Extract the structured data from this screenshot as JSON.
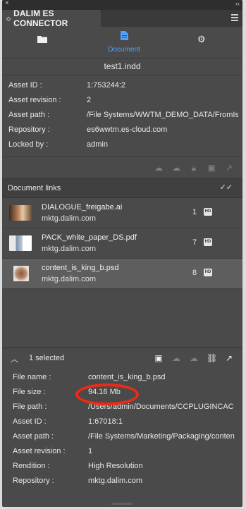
{
  "window": {
    "close": "×",
    "collapse": "‹‹"
  },
  "panel": {
    "title": "DALIM ES CONNECTOR"
  },
  "nav": {
    "document_label": "Document"
  },
  "file": {
    "name": "test1.indd"
  },
  "asset_info": [
    {
      "label": "Asset ID :",
      "value": "1:753244:2"
    },
    {
      "label": "Asset revision :",
      "value": "2"
    },
    {
      "label": "Asset path :",
      "value": "/File Systems/WWTM_DEMO_DATA/FromIsa"
    },
    {
      "label": "Repository :",
      "value": "es6wwtm.es-cloud.com"
    },
    {
      "label": "Locked by :",
      "value": "admin"
    }
  ],
  "links": {
    "title": "Document links",
    "items": [
      {
        "name": "DIALOGUE_freigabe.ai",
        "host": "mktg.dalim.com",
        "count": "1",
        "badge": "HD"
      },
      {
        "name": "PACK_white_paper_DS.pdf",
        "host": "mktg.dalim.com",
        "count": "7",
        "badge": "HD"
      },
      {
        "name": "content_is_king_b.psd",
        "host": "mktg.dalim.com",
        "count": "8",
        "badge": "HD"
      }
    ]
  },
  "selection": {
    "summary": "1 selected",
    "details": [
      {
        "label": "File name :",
        "value": "content_is_king_b.psd"
      },
      {
        "label": "File size :",
        "value": "94.16 Mb"
      },
      {
        "label": "File path :",
        "value": "/Users/admin/Documents/CCPLUGINCAC"
      },
      {
        "label": "Asset ID :",
        "value": "1:67018:1"
      },
      {
        "label": "Asset path :",
        "value": "/File Systems/Marketing/Packaging/conten"
      },
      {
        "label": "Asset revision :",
        "value": "1"
      },
      {
        "label": "Rendition :",
        "value": "High Resolution"
      },
      {
        "label": "Repository :",
        "value": "mktg.dalim.com"
      }
    ]
  },
  "colors": {
    "accent": "#4ea1ff",
    "highlight_ring": "#ee2a17",
    "panel_bg": "#4a4a4a"
  }
}
